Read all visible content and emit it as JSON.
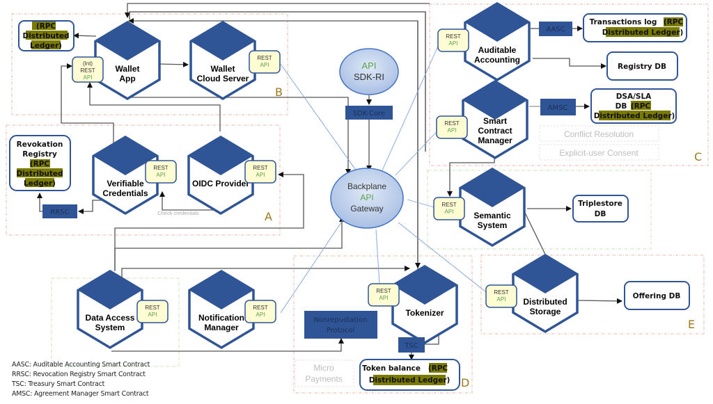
{
  "diagram": {
    "regions": {
      "A": {
        "letter": "A"
      },
      "B": {
        "letter": "B"
      },
      "C": {
        "letter": "C"
      },
      "D": {
        "letter": "D"
      },
      "E": {
        "letter": "E"
      }
    },
    "services": {
      "wallet_app": {
        "line1": "Wallet",
        "line2": "App"
      },
      "wallet_cloud": {
        "line1": "Wallet",
        "line2": "Cloud Server"
      },
      "verifiable_credentials": {
        "line1": "Verifiable",
        "line2": "Credentials"
      },
      "oidc_provider": {
        "line1": "OIDC Provider",
        "line2": ""
      },
      "data_access": {
        "line1": "Data Access",
        "line2": "System"
      },
      "notification_manager": {
        "line1": "Notification",
        "line2": "Manager"
      },
      "auditable_accounting": {
        "line1": "Auditable",
        "line2": "Accounting"
      },
      "smart_contract_manager": {
        "line1": "Smart",
        "line2": "Contract",
        "line3": "Manager"
      },
      "semantic_system": {
        "line1": "Semantic",
        "line2": "System"
      },
      "tokenizer": {
        "line1": "Tokenizer"
      },
      "distributed_storage": {
        "line1": "Distributed",
        "line2": "Storage"
      }
    },
    "rest_api": {
      "int": "(Int)",
      "rest": "REST",
      "api": "API"
    },
    "gateway": {
      "line1": "Backplane",
      "line2": "API",
      "line3": "Gateway"
    },
    "sdk_ri": {
      "line1": "API",
      "line2": "SDK-RI"
    },
    "sdk_core": "SDK-Core",
    "smart_contracts": {
      "aasc": "AASC",
      "amsc": "AMSC",
      "rrsc": "RRSC",
      "tsc": "TSC",
      "nonrepudiation_1": "Nonrepudiation",
      "nonrepudiation_2": "Protocol"
    },
    "stores": {
      "wallet_ledger": {
        "l1": "(RPC",
        "l2": "Distributed",
        "l3": "Ledger)"
      },
      "revocation_registry": {
        "l1": "Revokation",
        "l2": "Registry",
        "l3": "(RPC",
        "l4": "Distributed",
        "l5": "Ledger)"
      },
      "transactions_log": {
        "l1a": "Transactions log ",
        "l1b": "(RPC",
        "l2": "Distributed Ledger)"
      },
      "registry_db": {
        "l1": "Registry DB"
      },
      "dsa_sla": {
        "l1": "DSA/SLA",
        "l2a": "DB ",
        "l2b": "(RPC",
        "l3": "Distributed Ledger)"
      },
      "triplestore": {
        "l1": "Triplestore",
        "l2": "DB"
      },
      "offering_db": {
        "l1": "Offering DB"
      },
      "token_balance": {
        "l1a": "Token balance ",
        "l1b": "(RPC",
        "l2": "Distributed Ledger)"
      }
    },
    "faint_labels": {
      "conflict_resolution": "Conflict Resolution",
      "explicit_consent": "Explicit-user Consent",
      "micro_1": "Micro",
      "micro_2": "Payments",
      "check_credentials": "Check credentials"
    },
    "legend": [
      "AASC: Auditable Accounting Smart Contract",
      "RRSC: Revocation Registry Smart Contract",
      "TSC: Treasury Smart Contract",
      "AMSC: Agreement Manager Smart Contract"
    ],
    "colors": {
      "hex_blue": "#2f5597",
      "rest_fill": "#fdfcd3",
      "gateway_fill": "#b4c7e7",
      "highlight": "#7a7a00",
      "region_letter": "#9c7a1a",
      "api_green": "#5aa050"
    }
  }
}
